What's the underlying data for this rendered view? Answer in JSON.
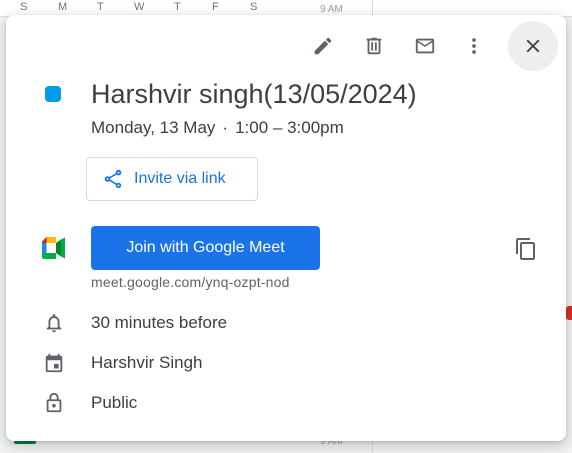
{
  "background": {
    "week_days": [
      "S",
      "M",
      "T",
      "W",
      "T",
      "F",
      "S"
    ],
    "time_label": "9 AM"
  },
  "toolbar": {
    "icons": [
      "pencil-icon",
      "trash-icon",
      "mail-icon",
      "more-vert-icon",
      "close-icon"
    ]
  },
  "event": {
    "color": "#039be5",
    "title": "Harshvir singh(13/05/2024)",
    "date": "Monday, 13 May",
    "separator": "·",
    "time": "1:00 – 3:00pm"
  },
  "invite": {
    "label": "Invite via link",
    "icon": "share-icon"
  },
  "meet": {
    "join_label": "Join with Google Meet",
    "link": "meet.google.com/ynq-ozpt-nod",
    "copy_icon": "copy-icon",
    "button_color": "#1a73e8"
  },
  "details": {
    "reminder": "30 minutes before",
    "calendar": "Harshvir Singh",
    "visibility": "Public"
  }
}
